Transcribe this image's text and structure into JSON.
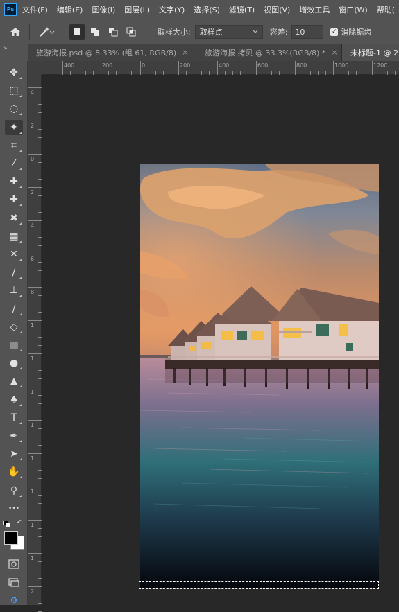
{
  "app": {
    "logo": "Ps"
  },
  "menu": [
    "文件(F)",
    "编辑(E)",
    "图像(I)",
    "图层(L)",
    "文字(Y)",
    "选择(S)",
    "滤镜(T)",
    "视图(V)",
    "增效工具",
    "窗口(W)",
    "帮助("
  ],
  "options": {
    "sample_size_label": "取样大小:",
    "sample_size_value": "取样点",
    "tolerance_label": "容差:",
    "tolerance_value": "10",
    "antialias_label": "消除锯齿",
    "antialias_checked": true
  },
  "tabs": [
    {
      "label": "旅游海报.psd @ 8.33% (组 61, RGB/8)",
      "close": "×",
      "active": false
    },
    {
      "label": "旅游海报 拷贝 @ 33.3%(RGB/8) *",
      "close": "×",
      "active": false
    },
    {
      "label": "未标题-1 @ 27",
      "close": "",
      "active": true
    }
  ],
  "toolbar": {
    "collapse_glyph": "»",
    "tools": [
      {
        "name": "move-tool-icon",
        "glyph": "✥",
        "active": false
      },
      {
        "name": "rect-marquee-tool-icon",
        "glyph": "⬚",
        "active": false
      },
      {
        "name": "lasso-tool-icon",
        "glyph": "◌",
        "active": false
      },
      {
        "name": "magic-wand-tool-icon",
        "glyph": "✦",
        "active": true
      },
      {
        "name": "crop-tool-icon",
        "glyph": "⌗",
        "active": false
      },
      {
        "name": "eyedropper-tool-icon",
        "glyph": "⁄",
        "active": false
      },
      {
        "name": "spot-healing-tool-icon",
        "glyph": "✚",
        "active": false
      },
      {
        "name": "healing-brush-tool-icon",
        "glyph": "✚",
        "active": false
      },
      {
        "name": "patch-tool-icon",
        "glyph": "✖",
        "active": false
      },
      {
        "name": "stamp-grid-tool-icon",
        "glyph": "▦",
        "active": false
      },
      {
        "name": "content-aware-move-tool-icon",
        "glyph": "✕",
        "active": false
      },
      {
        "name": "brush-tool-icon",
        "glyph": "∕",
        "active": false
      },
      {
        "name": "clone-stamp-tool-icon",
        "glyph": "⊥",
        "active": false
      },
      {
        "name": "history-brush-tool-icon",
        "glyph": "∕",
        "active": false
      },
      {
        "name": "eraser-tool-icon",
        "glyph": "◇",
        "active": false
      },
      {
        "name": "gradient-tool-icon",
        "glyph": "▥",
        "active": false
      },
      {
        "name": "blur-tool-icon",
        "glyph": "●",
        "active": false
      },
      {
        "name": "sharpen-tool-icon",
        "glyph": "▲",
        "active": false
      },
      {
        "name": "dodge-tool-icon",
        "glyph": "♠",
        "active": false
      },
      {
        "name": "type-tool-icon",
        "glyph": "T",
        "active": false
      },
      {
        "name": "pen-tool-icon",
        "glyph": "✒",
        "active": false
      },
      {
        "name": "path-selection-tool-icon",
        "glyph": "➤",
        "active": false
      },
      {
        "name": "hand-tool-icon",
        "glyph": "✋",
        "active": false
      },
      {
        "name": "zoom-tool-icon",
        "glyph": "⚲",
        "active": false
      },
      {
        "name": "more-tools-icon",
        "glyph": "•••",
        "active": false
      }
    ]
  },
  "colors": {
    "foreground": "#000000",
    "background": "#ffffff"
  },
  "ruler": {
    "h_labels": [
      "400",
      "200",
      "0",
      "200",
      "400",
      "600",
      "800",
      "1000",
      "1200"
    ],
    "v_labels": [
      "4",
      "2",
      "0",
      "2",
      "4",
      "6",
      "8",
      "1",
      "1",
      "1",
      "1",
      "1",
      "1",
      "1",
      "1",
      "2"
    ]
  }
}
